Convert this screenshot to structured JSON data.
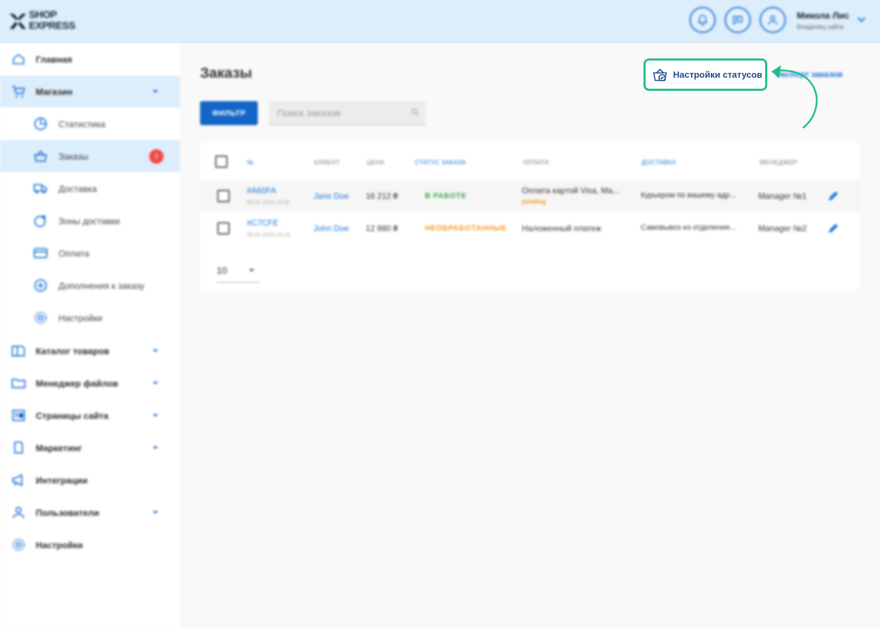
{
  "header": {
    "logo_line1": "SHOP",
    "logo_line2": "EXPRESS",
    "user_name": "Микола Лис",
    "user_role": "Владелец сайта",
    "accent": "#1c75d8",
    "bg": "#dcedfb"
  },
  "sidebar": {
    "items": [
      {
        "label": "Главная",
        "icon": "home-icon"
      },
      {
        "label": "Магазин",
        "icon": "cart-icon"
      },
      {
        "label": "Статистика",
        "icon": "pie-chart-icon"
      },
      {
        "label": "Заказы",
        "icon": "basket-icon",
        "badge": "1"
      },
      {
        "label": "Доставка",
        "icon": "truck-icon"
      },
      {
        "label": "Зоны доставки",
        "icon": "globe-icon"
      },
      {
        "label": "Оплата",
        "icon": "card-icon"
      },
      {
        "label": "Дополнения к заказу",
        "icon": "plus-circle-icon"
      },
      {
        "label": "Настройки",
        "icon": "gear-icon"
      },
      {
        "label": "Каталог товаров",
        "icon": "book-icon"
      },
      {
        "label": "Менеджер файлов",
        "icon": "folder-icon"
      },
      {
        "label": "Страницы сайта",
        "icon": "page-icon"
      },
      {
        "label": "Маркетинг",
        "icon": "tag-icon"
      },
      {
        "label": "Интеграции",
        "icon": "megaphone-icon"
      },
      {
        "label": "Пользователи",
        "icon": "user-icon"
      },
      {
        "label": "Настройки",
        "icon": "gear-icon"
      }
    ]
  },
  "main": {
    "title": "Заказы",
    "filter_label": "ФИЛЬТР",
    "search_placeholder": "Поиск заказов",
    "status_settings_label": "Настройки статусов",
    "export_label": "Экспорт заказов",
    "columns": [
      "№",
      "Клиент",
      "Цена",
      "Статус заказа",
      "Оплата",
      "Доставка",
      "Менеджер"
    ],
    "rows": [
      {
        "id": "#A60FA",
        "date": "08.02.2023 14:30",
        "client": "Jane Doe",
        "price": "16 212 ₴",
        "status": "В РАБОТЕ",
        "payment": "Оплата картой Visa, Ma...",
        "payment_status": "pending",
        "delivery": "Курьером по вашему адр...",
        "manager": "Manager №1"
      },
      {
        "id": "#C7CFE",
        "date": "08.02.2023 14:19",
        "client": "John Doe",
        "price": "12 880 ₴",
        "status": "НЕОБРАБОТАННЫЕ",
        "payment": "Наложенный платеж",
        "payment_status": "",
        "delivery": "Самовывоз из отделения...",
        "manager": "Manager №2"
      }
    ],
    "per_page": "10"
  }
}
